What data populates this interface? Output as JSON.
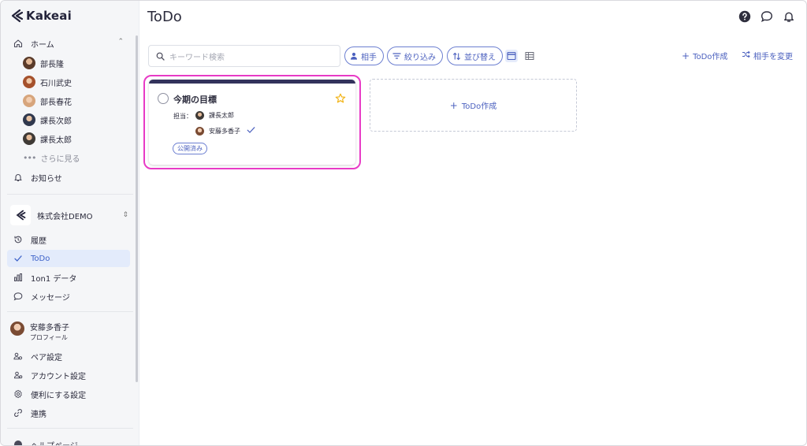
{
  "app": {
    "name": "Kakeai"
  },
  "sidebar": {
    "home_label": "ホーム",
    "people": [
      {
        "name": "部長隆"
      },
      {
        "name": "石川武史"
      },
      {
        "name": "部長春花"
      },
      {
        "name": "課長次郎"
      },
      {
        "name": "課長太郎"
      }
    ],
    "more_label": "さらに見る",
    "notifications_label": "お知らせ",
    "company_name": "株式会社DEMO",
    "nav": [
      {
        "label": "履歴",
        "icon": "history-icon"
      },
      {
        "label": "ToDo",
        "icon": "check-icon"
      },
      {
        "label": "1on1 データ",
        "icon": "bar-chart-icon"
      },
      {
        "label": "メッセージ",
        "icon": "message-icon"
      }
    ],
    "profile": {
      "name": "安藤多香子",
      "sub": "プロフィール"
    },
    "settings": [
      {
        "label": "ペア設定",
        "icon": "pair-settings-icon"
      },
      {
        "label": "アカウント設定",
        "icon": "account-settings-icon"
      },
      {
        "label": "便利にする設定",
        "icon": "gear-icon"
      },
      {
        "label": "連携",
        "icon": "link-icon"
      }
    ],
    "help_label": "ヘルプページ"
  },
  "main": {
    "title": "ToDo",
    "search_placeholder": "キーワード検索",
    "filters": {
      "partner": "相手",
      "narrow": "絞り込み",
      "sort": "並び替え"
    },
    "actions": {
      "create_todo": "ToDo作成",
      "change_partner": "相手を変更"
    },
    "card": {
      "title": "今期の目標",
      "assign_label": "担当：",
      "assignees": [
        "課長太郎",
        "安藤多香子"
      ],
      "status_badge": "公開済み",
      "starred": true
    },
    "new_card_label": "ToDo作成"
  },
  "colors": {
    "accent": "#4c61bf",
    "highlight": "#e83bc6",
    "card_header": "#33335c",
    "star": "#f2b418"
  }
}
